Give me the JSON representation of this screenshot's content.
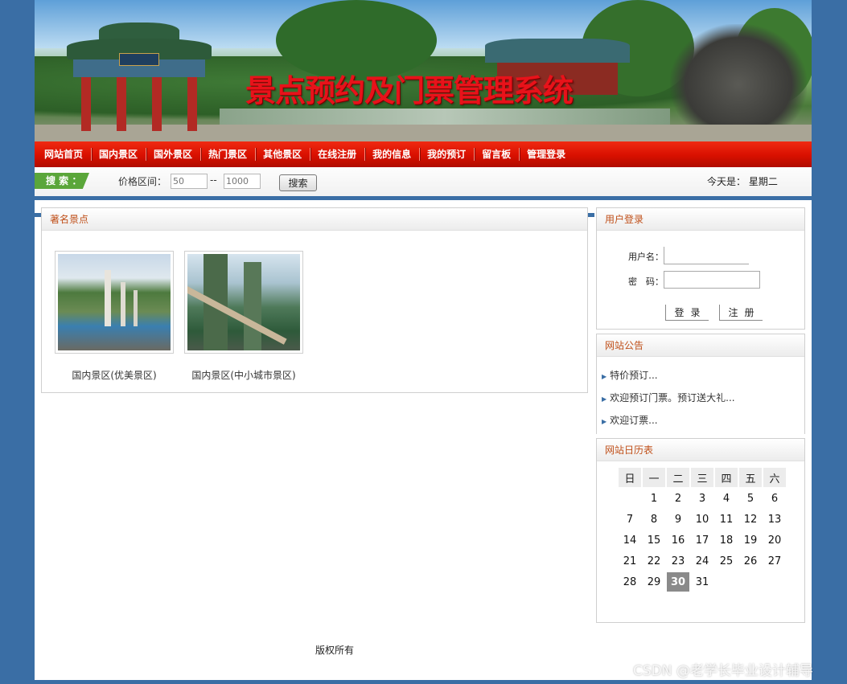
{
  "banner": {
    "title": "景点预约及门票管理系统"
  },
  "nav": {
    "items": [
      "网站首页",
      "国内景区",
      "国外景区",
      "热门景区",
      "其他景区",
      "在线注册",
      "我的信息",
      "我的预订",
      "留言板",
      "管理登录"
    ]
  },
  "search": {
    "tag": "搜 索 ：",
    "price_label": "价格区间：",
    "min_placeholder": "50",
    "max_placeholder": "1000",
    "separator": "--",
    "button": "搜索",
    "today_label": "今天是：",
    "weekday": "星期二"
  },
  "spots": {
    "title": "著名景点",
    "items": [
      {
        "caption": "国内景区(优美景区)"
      },
      {
        "caption": "国内景区(中小城市景区)"
      }
    ]
  },
  "login": {
    "title": "用户登录",
    "username_label": "用户名：",
    "password_label": "密　码：",
    "login_button": "登录",
    "register_button": "注册"
  },
  "notice": {
    "title": "网站公告",
    "items": [
      "特价预订...",
      "欢迎预订门票。预订送大礼...",
      "欢迎订票..."
    ]
  },
  "calendar": {
    "title": "网站日历表",
    "weekdays": [
      "日",
      "一",
      "二",
      "三",
      "四",
      "五",
      "六"
    ],
    "weeks": [
      [
        "",
        "1",
        "2",
        "3",
        "4",
        "5",
        "6"
      ],
      [
        "7",
        "8",
        "9",
        "10",
        "11",
        "12",
        "13"
      ],
      [
        "14",
        "15",
        "16",
        "17",
        "18",
        "19",
        "20"
      ],
      [
        "21",
        "22",
        "23",
        "24",
        "25",
        "26",
        "27"
      ],
      [
        "28",
        "29",
        "30",
        "31",
        "",
        "",
        ""
      ]
    ],
    "today": "30"
  },
  "footer": {
    "text": "版权所有"
  },
  "watermark": {
    "text": "CSDN @老学长毕业设计辅导"
  },
  "colors": {
    "nav_red": "#d81000",
    "page_blue": "#3a6ea5",
    "panel_title": "#c0501a",
    "search_green": "#5aa63a"
  }
}
